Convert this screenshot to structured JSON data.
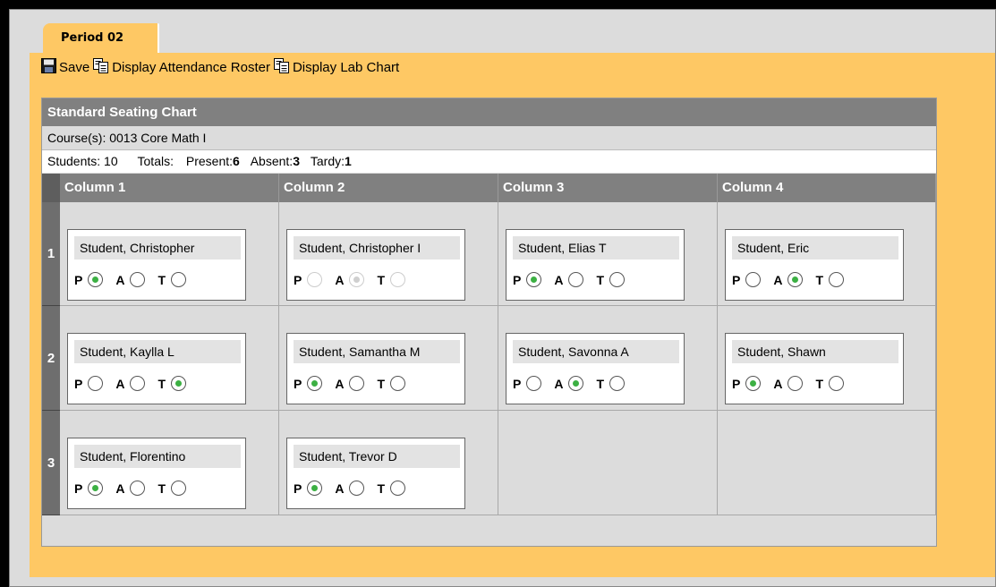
{
  "tab": {
    "label": "Period 02"
  },
  "toolbar": {
    "save_label": "Save",
    "roster_label": "Display Attendance Roster",
    "lab_label": "Display Lab Chart"
  },
  "chart": {
    "title": "Standard Seating Chart",
    "course": "Course(s): 0013 Core Math I",
    "students_label": "Students: 10",
    "totals_label": "Totals:",
    "present_label": "Present:",
    "present_value": "6",
    "absent_label": "Absent:",
    "absent_value": "3",
    "tardy_label": "Tardy:",
    "tardy_value": "1"
  },
  "columns": [
    "Column 1",
    "Column 2",
    "Column 3",
    "Column 4"
  ],
  "rows": [
    "1",
    "2",
    "3"
  ],
  "option_labels": {
    "p": "P",
    "a": "A",
    "t": "T"
  },
  "seats": [
    [
      {
        "name": "Student, Christopher",
        "status": "P",
        "disabled": false
      },
      {
        "name": "Student, Christopher I",
        "status": "A",
        "disabled": true
      },
      {
        "name": "Student, Elias T",
        "status": "P",
        "disabled": false
      },
      {
        "name": "Student, Eric",
        "status": "A",
        "disabled": false
      }
    ],
    [
      {
        "name": "Student, Kaylla L",
        "status": "T",
        "disabled": false
      },
      {
        "name": "Student, Samantha M",
        "status": "P",
        "disabled": false
      },
      {
        "name": "Student, Savonna A",
        "status": "A",
        "disabled": false
      },
      {
        "name": "Student, Shawn",
        "status": "P",
        "disabled": false
      }
    ],
    [
      {
        "name": "Student, Florentino",
        "status": "P",
        "disabled": false
      },
      {
        "name": "Student, Trevor D",
        "status": "P",
        "disabled": false
      },
      null,
      null
    ]
  ],
  "colors": {
    "tab_bg": "#fec864",
    "header_bg": "#808080",
    "selected": "#3cb043"
  },
  "icons": {
    "save": "floppy-disk-icon",
    "roster": "document-copy-icon",
    "lab": "document-copy-icon"
  }
}
